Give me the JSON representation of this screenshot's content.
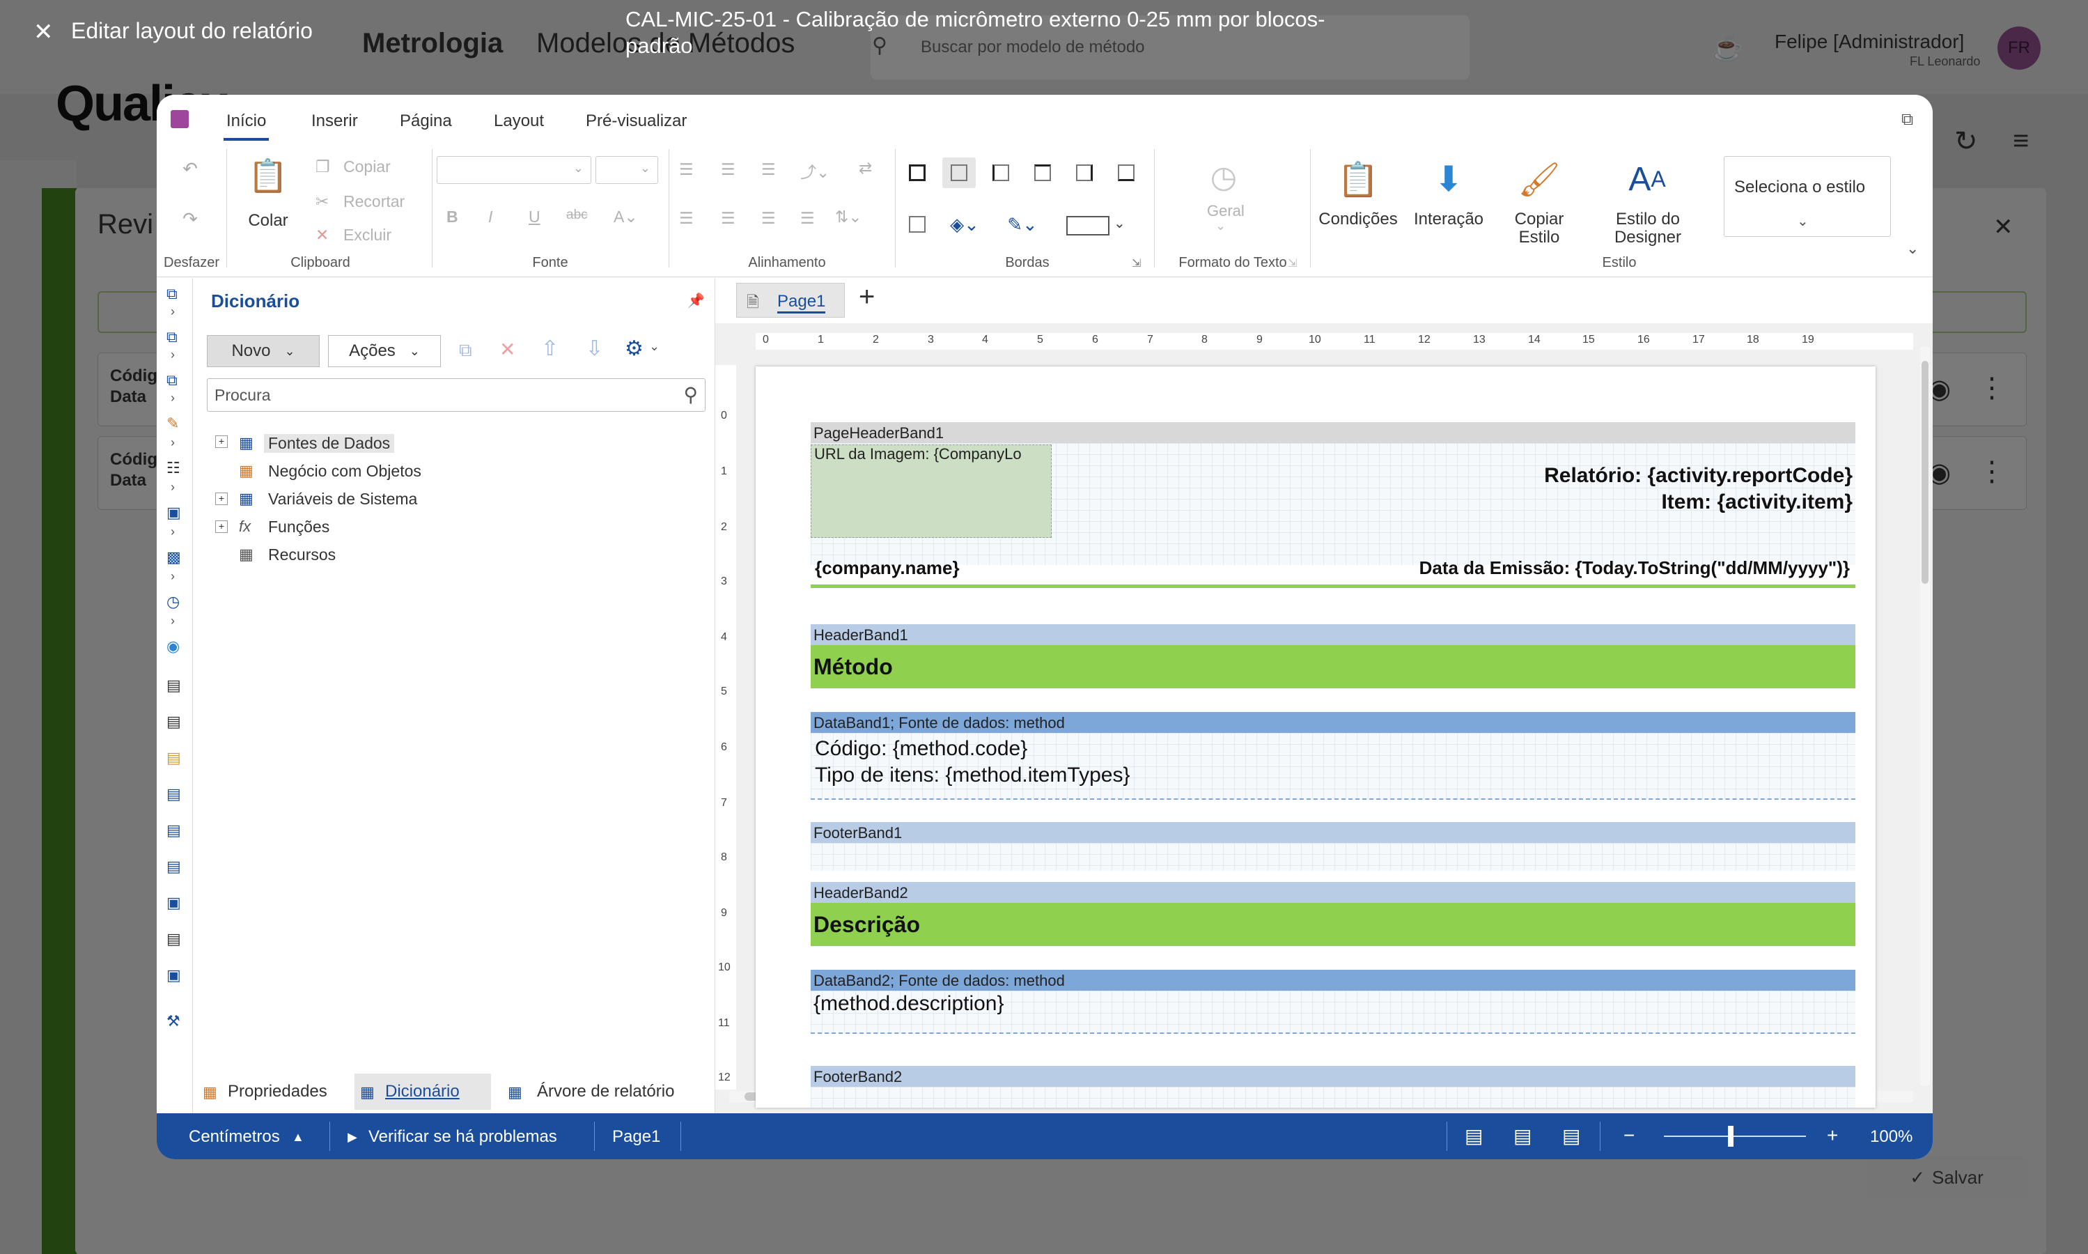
{
  "background": {
    "app_name": "Qualiex",
    "module": "Metrologia",
    "section": "Modelos de Métodos",
    "search_placeholder": "Buscar por modelo de método",
    "user_name": "Felipe [Administrador]",
    "user_org": "FL Leonardo",
    "user_initials": "FR",
    "panel_title": "Revi",
    "row1_line1": "Códig",
    "row1_line2": "Data",
    "row2_line1": "Códig",
    "row2_line2": "Data",
    "save_label": "Salvar"
  },
  "header": {
    "close_label": "Editar layout do relatório",
    "doc_title_line1": "CAL-MIC-25-01 - Calibração de micrômetro externo 0-25 mm por blocos-",
    "doc_title_line2": "padrão"
  },
  "tabs": [
    "Início",
    "Inserir",
    "Página",
    "Layout",
    "Pré-visualizar"
  ],
  "ribbon": {
    "undo_group": "Desfazer",
    "paste": "Colar",
    "copy": "Copiar",
    "cut": "Recortar",
    "delete": "Excluir",
    "clipboard_group": "Clipboard",
    "font_group": "Fonte",
    "align_group": "Alinhamento",
    "borders_group": "Bordas",
    "text_format": "Geral",
    "text_format_group": "Formato do Texto",
    "conditions": "Condições",
    "interaction": "Interação",
    "copy_style_1": "Copiar",
    "copy_style_2": "Estilo",
    "designer_style_1": "Estilo do",
    "designer_style_2": "Designer",
    "style_select": "Seleciona o estilo",
    "style_group": "Estilo"
  },
  "dictionary": {
    "title": "Dicionário",
    "new": "Novo",
    "actions": "Ações",
    "search_placeholder": "Procura",
    "items": [
      "Fontes de Dados",
      "Negócio com Objetos",
      "Variáveis de Sistema",
      "Funções",
      "Recursos"
    ]
  },
  "bottom_tabs": [
    "Propriedades",
    "Dicionário",
    "Árvore de relatório"
  ],
  "page_tab": "Page1",
  "ruler": {
    "h": [
      "0",
      "1",
      "2",
      "3",
      "4",
      "5",
      "6",
      "7",
      "8",
      "9",
      "10",
      "11",
      "12",
      "13",
      "14",
      "15",
      "16",
      "17",
      "18",
      "19"
    ],
    "v": [
      "0",
      "1",
      "2",
      "3",
      "4",
      "5",
      "6",
      "7",
      "8",
      "9",
      "10",
      "11",
      "12"
    ]
  },
  "report": {
    "page_header_band": "PageHeaderBand1",
    "image_url": "URL da Imagem: {CompanyLo",
    "report_code": "Relatório: {activity.reportCode}",
    "item": "Item: {activity.item}",
    "company": "{company.name}",
    "emission": "Data da Emissão: {Today.ToString(\"dd/MM/yyyy\")}",
    "header_band1": "HeaderBand1",
    "method": "Método",
    "data_band1": "DataBand1; Fonte de dados: method",
    "code": "Código: {method.code}",
    "item_types": "Tipo de itens: {method.itemTypes}",
    "footer_band1": "FooterBand1",
    "header_band2": "HeaderBand2",
    "description_title": "Descrição",
    "data_band2": "DataBand2; Fonte de dados: method",
    "description": "{method.description}",
    "footer_band2": "FooterBand2"
  },
  "status": {
    "units": "Centímetros",
    "check": "Verificar se há problemas",
    "page": "Page1",
    "zoom": "100%",
    "zoom_minus": "−",
    "zoom_plus": "+"
  },
  "colors": {
    "primary": "#1a4e9c",
    "band_green": "#8fd14f",
    "band_blue": "#b8cce6",
    "band_data": "#7da6d9"
  }
}
